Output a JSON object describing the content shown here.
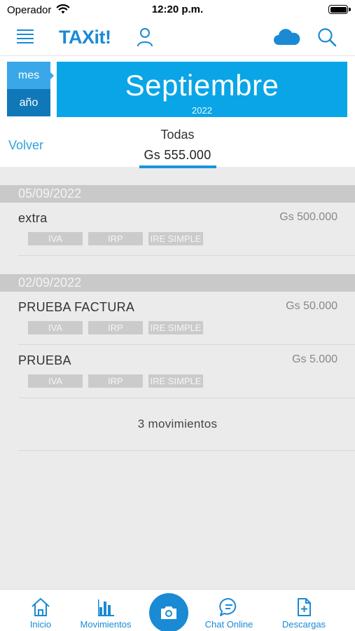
{
  "status_bar": {
    "carrier": "Operador",
    "time": "12:20 p.m."
  },
  "nav": {
    "logo": "TAXit!",
    "icons": [
      "menu-icon",
      "user-icon",
      "cloud-icon",
      "search-icon"
    ]
  },
  "period": {
    "toggle": {
      "month": "mes",
      "year": "año"
    },
    "month": "Septiembre",
    "year": "2022",
    "back_label": "Volver",
    "filter_label": "Todas",
    "total": "Gs 555.000"
  },
  "groups": [
    {
      "date": "05/09/2022",
      "entries": [
        {
          "name": "extra",
          "amount": "Gs 500.000",
          "tags": [
            "IVA",
            "IRP",
            "IRE SIMPLE"
          ]
        }
      ]
    },
    {
      "date": "02/09/2022",
      "entries": [
        {
          "name": "PRUEBA FACTURA",
          "amount": "Gs 50.000",
          "tags": [
            "IVA",
            "IRP",
            "IRE SIMPLE"
          ]
        },
        {
          "name": "PRUEBA",
          "amount": "Gs 5.000",
          "tags": [
            "IVA",
            "IRP",
            "IRE SIMPLE"
          ]
        }
      ]
    }
  ],
  "summary": "3 movimientos",
  "tabbar": [
    {
      "label": "Inicio",
      "icon": "home-icon"
    },
    {
      "label": "Movimientos",
      "icon": "bar-chart-icon"
    },
    {
      "label": "",
      "icon": "camera-icon"
    },
    {
      "label": "Chat Online",
      "icon": "chat-icon"
    },
    {
      "label": "Descargas",
      "icon": "download-file-icon"
    }
  ],
  "colors": {
    "accent": "#1a8ad4",
    "month_box": "#0aa5e6",
    "tag": "#cbcbcb",
    "date_header": "#c9c9c9"
  }
}
